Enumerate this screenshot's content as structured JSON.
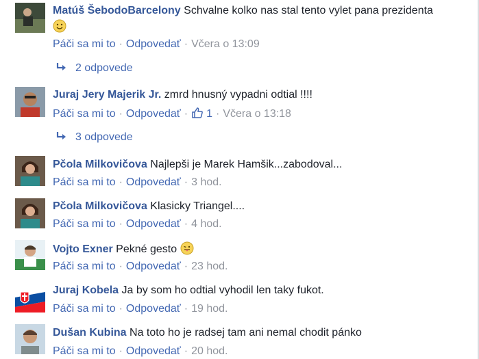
{
  "actions": {
    "like": "Páči sa mi to",
    "reply": "Odpovedať",
    "sep": "·"
  },
  "comments": [
    {
      "author": "Matúš ŠebodoBarcelony",
      "text": "Schvalne kolko nas stal tento vylet pana prezidenta",
      "emoji": "smile-emoji",
      "time": "Včera o 13:09",
      "replies": "2 odpovede"
    },
    {
      "author": "Juraj Jery Majerik Jr.",
      "text": "zmrd hnusný vypadni odtial !!!!",
      "likes": "1",
      "time": "Včera o 13:18",
      "replies": "3 odpovede"
    },
    {
      "author": "Pčola Milkovičova",
      "text": "Najlepši je Marek Hamšik...zabodoval...",
      "time": "3 hod."
    },
    {
      "author": "Pčola Milkovičova",
      "text": "Klasicky Triangel....",
      "time": "4 hod."
    },
    {
      "author": "Vojto Exner",
      "text": "Pekné gesto",
      "emoji": "tongue-emoji",
      "time": "23 hod."
    },
    {
      "author": "Juraj Kobela",
      "text": "Ja by som ho odtial vyhodil len taky fukot.",
      "time": "19 hod."
    },
    {
      "author": "Dušan Kubina",
      "text": "Na toto ho je radsej tam ani nemal chodit pánko",
      "time": "20 hod."
    }
  ],
  "colors": {
    "author": "#365899",
    "link": "#4267b2",
    "meta": "#90949c"
  }
}
